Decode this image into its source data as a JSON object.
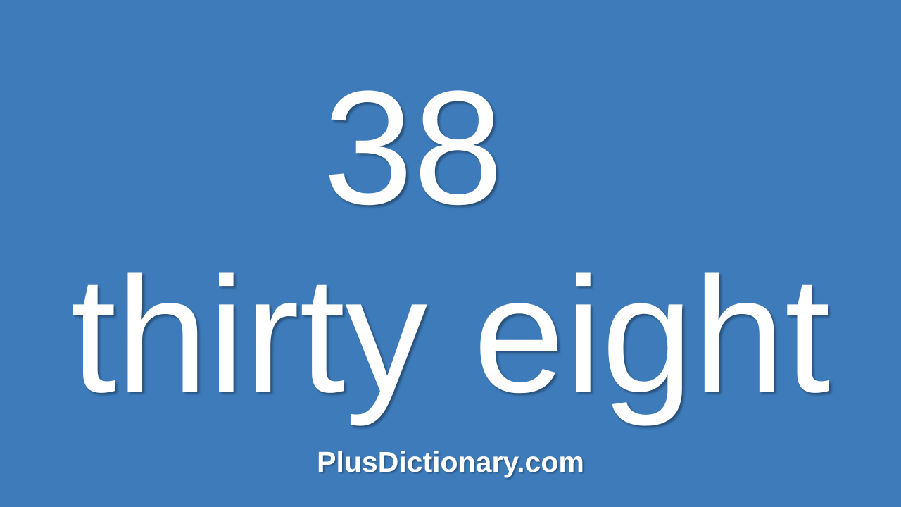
{
  "slide": {
    "numeral": "38",
    "words": "thirty eight",
    "site": "PlusDictionary.com"
  },
  "colors": {
    "background": "#3d7bba",
    "text": "#ffffff"
  }
}
